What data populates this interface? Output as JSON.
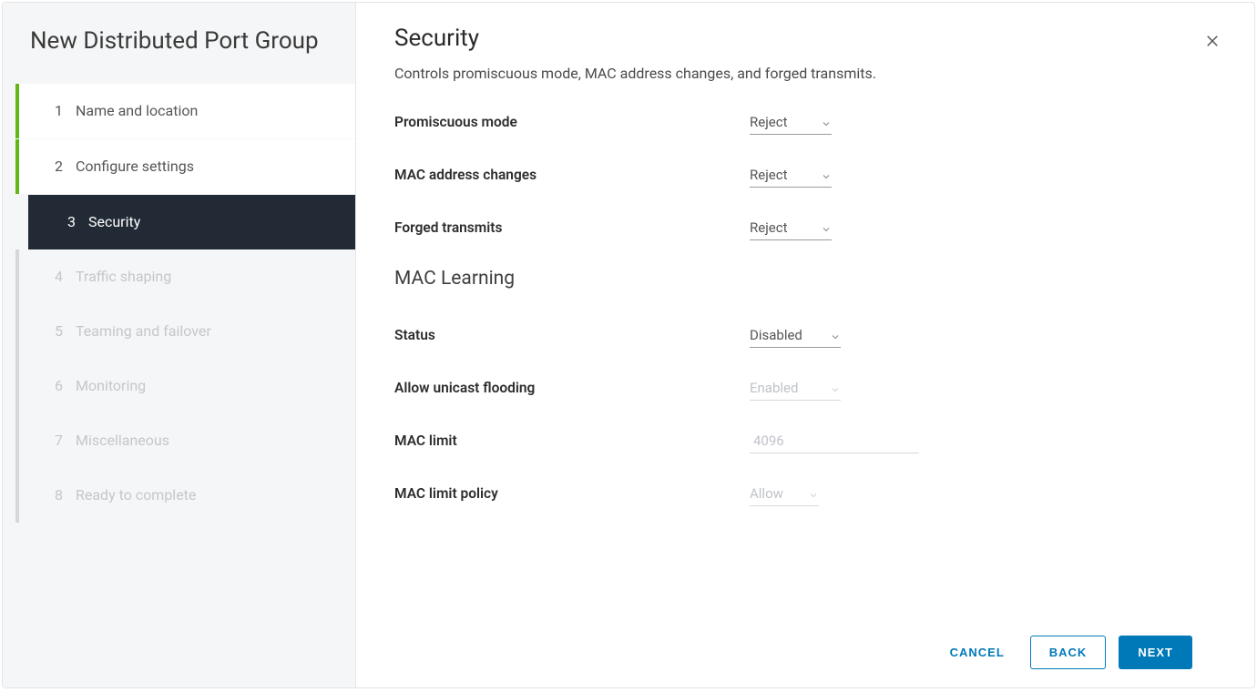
{
  "wizard": {
    "title": "New Distributed Port Group",
    "steps": [
      {
        "num": "1",
        "label": "Name and location",
        "state": "completed"
      },
      {
        "num": "2",
        "label": "Configure settings",
        "state": "completed"
      },
      {
        "num": "3",
        "label": "Security",
        "state": "current"
      },
      {
        "num": "4",
        "label": "Traffic shaping",
        "state": "pending"
      },
      {
        "num": "5",
        "label": "Teaming and failover",
        "state": "pending"
      },
      {
        "num": "6",
        "label": "Monitoring",
        "state": "pending"
      },
      {
        "num": "7",
        "label": "Miscellaneous",
        "state": "pending"
      },
      {
        "num": "8",
        "label": "Ready to complete",
        "state": "pending"
      }
    ]
  },
  "page": {
    "title": "Security",
    "description": "Controls promiscuous mode, MAC address changes, and forged transmits."
  },
  "security": {
    "promiscuous_label": "Promiscuous mode",
    "promiscuous_value": "Reject",
    "mac_changes_label": "MAC address changes",
    "mac_changes_value": "Reject",
    "forged_label": "Forged transmits",
    "forged_value": "Reject"
  },
  "mac_learning": {
    "heading": "MAC Learning",
    "status_label": "Status",
    "status_value": "Disabled",
    "unicast_label": "Allow unicast flooding",
    "unicast_value": "Enabled",
    "limit_label": "MAC limit",
    "limit_value": "4096",
    "policy_label": "MAC limit policy",
    "policy_value": "Allow"
  },
  "buttons": {
    "cancel": "CANCEL",
    "back": "BACK",
    "next": "NEXT"
  }
}
